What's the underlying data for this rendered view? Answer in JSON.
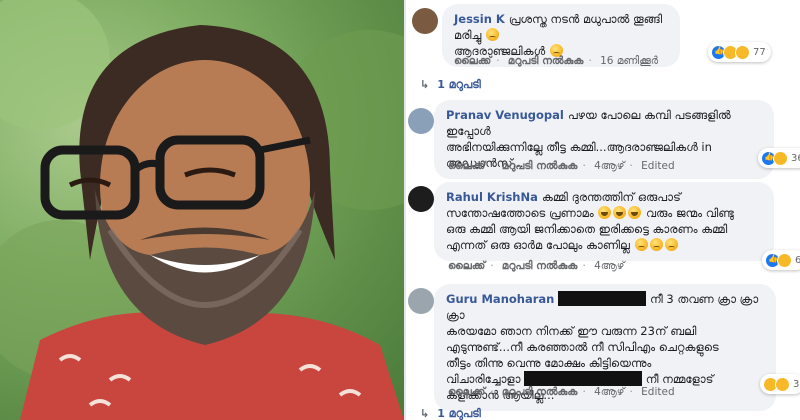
{
  "comments": [
    {
      "author": "Jessin K",
      "text_line1": "പ്രശസ്ത നടൻ മധുപാൽ തൂങ്ങി മരിച്ചു",
      "text_line2": "ആദരാഞ്ജലികൾ",
      "emoji_after_line1": "crying-face",
      "emoji_after_line2": "crying-face",
      "actions": {
        "like": "ലൈക്ക്",
        "reply": "മറുപടി നൽകുക",
        "time": "16 മണിക്കൂർ"
      },
      "reaction_count": "77",
      "reply_count_label": "1 മറുപടി"
    },
    {
      "author": "Pranav Venugopal",
      "text_line1": "പഴയ പോലെ കമ്പി പടങ്ങളിൽ ഇപ്പോൾ",
      "text_line2": "അഭിനയിക്കുന്നില്ലേ തീട്ട കമ്മി...ആദരാഞ്ജലികൾ in",
      "text_line3": "അഡ്വാൻസ്...",
      "actions": {
        "like": "ലൈക്ക്",
        "reply": "മറുപടി നൽകുക",
        "time": "4ആഴ്",
        "edited": "Edited"
      },
      "reaction_count": "36"
    },
    {
      "author": "Rahul KrishNa",
      "text_line1": "കമ്മി ദുരന്തത്തിന് ഒരുപാട്",
      "text_line2a": "സന്തോഷത്തോടെ പ്രണാമം",
      "text_line2b": "വരും ജന്മം വിണ്ടു",
      "text_line3": "ഒരു കമ്മി ആയി ജനിക്കാതെ ഇരിക്കട്ടെ കാരണം കമ്മി",
      "text_line4": "എന്നത് ഒരു ഓർമ പോലും കാണില്ല",
      "actions": {
        "like": "ലൈക്ക്",
        "reply": "മറുപടി നൽകുക",
        "time": "4ആഴ്"
      },
      "reaction_count": "6"
    },
    {
      "author": "Guru Manoharan",
      "text_line1": "നീ 3 തവണ ക്രാ ക്രാ ക്രാ",
      "text_line2": "കരയമോ ഞാന നിനക്ക് ഈ വരുന്ന 23ന് ബലി",
      "text_line3": "എടുന്നുണ്ട്...നീ കരഞ്ഞാൽ നീ സിപിഎം ചെറ്റകളുടെ",
      "text_line4": "തീട്ടം തിന്നു വെന്നു മോക്ഷം കിട്ടിയെന്നും",
      "text_line5a": "വിചാരിച്ചോളാ",
      "text_line5b": "നീ നമ്മളോട്",
      "text_line6": "കളിക്കാൻ ആയില്ല...",
      "actions": {
        "like": "ലൈക്ക്",
        "reply": "മറുപടി നൽകുക",
        "time": "4ആഴ്",
        "edited": "Edited"
      },
      "reaction_count": "3",
      "reply_count_label": "1 മറുപടി"
    }
  ],
  "colors": {
    "author_link": "#385898",
    "bubble": "#f0f2f5",
    "meta_text": "#65676b",
    "like_blue": "#1877f2",
    "emoji_yellow": "#f7b928"
  }
}
